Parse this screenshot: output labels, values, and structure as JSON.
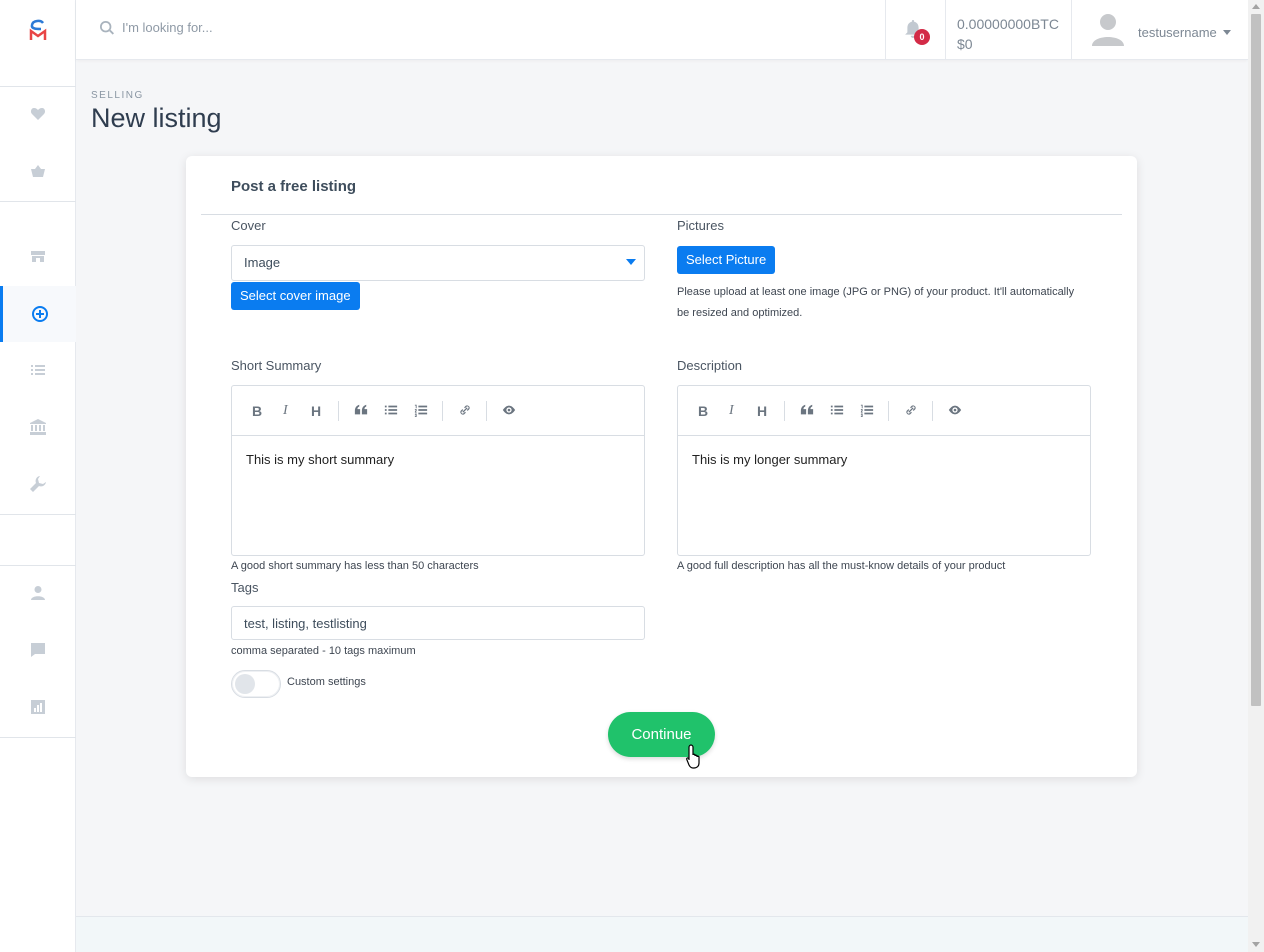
{
  "search": {
    "placeholder": "I'm looking for..."
  },
  "notifications": {
    "count": "0"
  },
  "wallet": {
    "btc": "0.00000000BTC",
    "usd": "$0"
  },
  "user": {
    "name": "testusername"
  },
  "page": {
    "crumb": "SELLING",
    "title": "New listing"
  },
  "card": {
    "title": "Post a free listing",
    "cover": {
      "label": "Cover",
      "selected": "Image",
      "button": "Select cover image"
    },
    "pictures": {
      "label": "Pictures",
      "button": "Select Picture",
      "help_line1": "Please upload at least one image (JPG or PNG) of your product. It'll automatically",
      "help_line2": "be resized and optimized."
    },
    "short_summary": {
      "label": "Short Summary",
      "text": "This is my short summary",
      "help": "A good short summary has less than 50 characters"
    },
    "description": {
      "label": "Description",
      "text": "This is my longer summary",
      "help": "A good full description has all the must-know details of your product"
    },
    "tags": {
      "label": "Tags",
      "value": "test, listing, testlisting",
      "help": "comma separated - 10 tags maximum"
    },
    "custom_settings": {
      "label": "Custom settings",
      "enabled": false
    },
    "continue": "Continue"
  },
  "toolbar_glyphs": {
    "bold": "B",
    "italic": "I",
    "heading": "H"
  },
  "colors": {
    "accent": "#0a7cf0",
    "success": "#20c26b",
    "badge": "#d32b47"
  }
}
